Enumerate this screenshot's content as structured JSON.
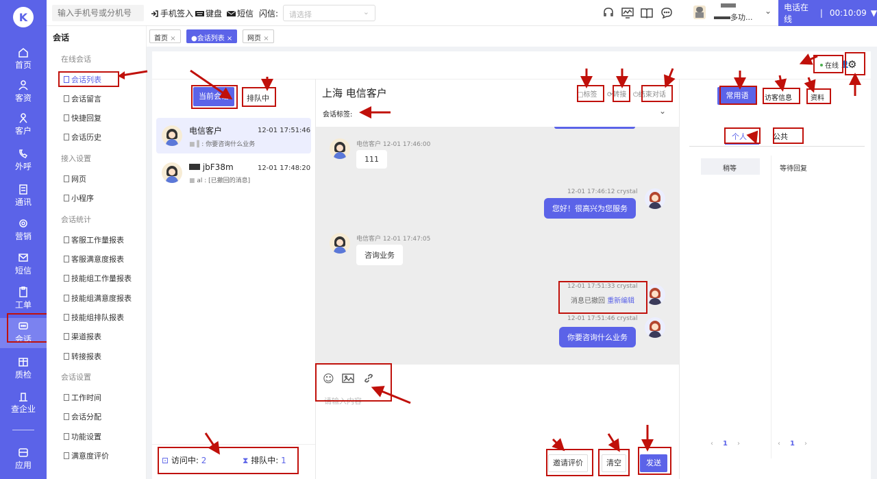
{
  "rail": {
    "items": [
      {
        "label": "首页",
        "icon": "home-icon"
      },
      {
        "label": "客资",
        "icon": "users-icon"
      },
      {
        "label": "客户",
        "icon": "customer-icon"
      },
      {
        "label": "外呼",
        "icon": "phone-out-icon"
      },
      {
        "label": "通讯",
        "icon": "contacts-icon"
      },
      {
        "label": "营销",
        "icon": "marketing-icon"
      },
      {
        "label": "短信",
        "icon": "sms-icon"
      },
      {
        "label": "工单",
        "icon": "clipboard-icon"
      },
      {
        "label": "会话",
        "icon": "chat-icon"
      },
      {
        "label": "质检",
        "icon": "quality-icon"
      },
      {
        "label": "查企业",
        "icon": "building-icon"
      },
      {
        "label": "应用",
        "icon": "apps-icon"
      }
    ]
  },
  "topbar": {
    "phone_placeholder": "输入手机号或分机号",
    "phone_checkin": "手机签入",
    "keyboard": "键盘",
    "sms": "短信",
    "flash_label": "闪信:",
    "flash_placeholder": "请选择",
    "user_text": "多功...",
    "online_label": "电话在线",
    "timer": "00:10:09"
  },
  "subnav": {
    "title": "会话",
    "groups": [
      {
        "label": "在线会话",
        "items": [
          "会话列表",
          "会话留言",
          "快捷回复",
          "会话历史"
        ]
      },
      {
        "label": "接入设置",
        "items": [
          "网页",
          "小程序"
        ]
      },
      {
        "label": "会话统计",
        "items": [
          "客服工作量报表",
          "客服满意度报表",
          "技能组工作量报表",
          "技能组满意度报表",
          "技能组排队报表",
          "渠道报表",
          "转接报表"
        ]
      },
      {
        "label": "会话设置",
        "items": [
          "工作时间",
          "会话分配",
          "功能设置",
          "满意度评价"
        ]
      }
    ]
  },
  "tabs": [
    {
      "label": "首页"
    },
    {
      "label": "会话列表"
    },
    {
      "label": "网页"
    }
  ],
  "status": {
    "online": "在线"
  },
  "list_panel": {
    "current_btn": "当前会话",
    "queue_btn": "排队中",
    "sessions": [
      {
        "name": "电信客户",
        "time": "12-01 17:51:46",
        "preview": "你要咨询什么业务"
      },
      {
        "name": "jbF38m",
        "time": "12-01 17:48:20",
        "preview": "al : [已撤回的消息]"
      }
    ],
    "visiting_label": "访问中:",
    "visiting_count": "2",
    "queue_label": "排队中:",
    "queue_count": "1"
  },
  "chat": {
    "title": "上海 电信客户",
    "tag_btn": "标签",
    "transfer_btn": "转接",
    "end_btn": "结束对话",
    "session_tag_label": "会话标签:",
    "messages": [
      {
        "side": "left",
        "meta": "电信客户 12-01 17:46:00",
        "text": "111"
      },
      {
        "side": "right",
        "meta": "12-01 17:46:12 crystal",
        "text": "您好！很高兴为您服务"
      },
      {
        "side": "left",
        "meta": "电信客户 12-01 17:47:05",
        "text": "咨询业务"
      },
      {
        "side": "right",
        "meta": "12-01 17:51:33 crystal",
        "text": "消息已撤回",
        "link": "重新编辑"
      },
      {
        "side": "right",
        "meta": "12-01 17:51:46 crystal",
        "text": "你要咨询什么业务"
      }
    ],
    "input_placeholder": "请输入内容",
    "invite_btn": "邀请评价",
    "clear_btn": "清空",
    "send_btn": "发送"
  },
  "right_panel": {
    "tabs": [
      "常用语",
      "访客信息",
      "资料"
    ],
    "subtabs": [
      "个人",
      "公共"
    ],
    "left_cell": "稍等",
    "right_cell": "等待回复",
    "page": "1"
  }
}
